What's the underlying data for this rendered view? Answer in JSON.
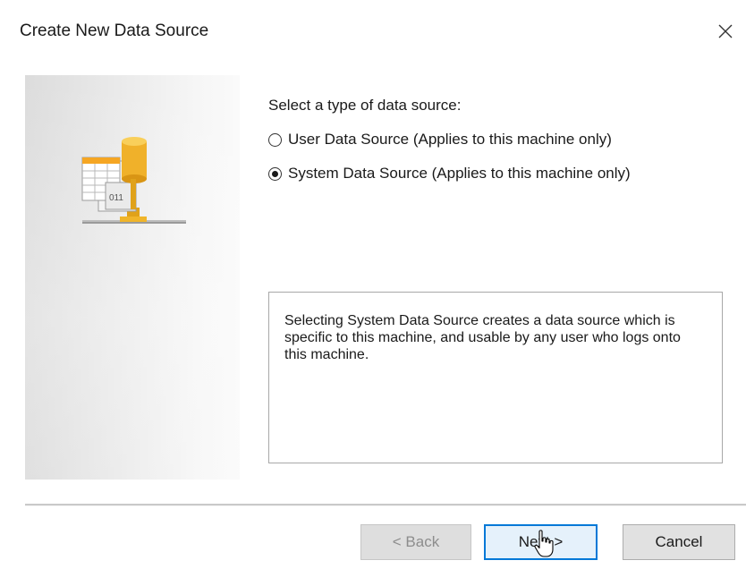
{
  "window": {
    "title": "Create New Data Source"
  },
  "icons": {
    "close": "close-icon",
    "wizard_art": "data-source-database-icon",
    "cursor": "hand-pointer-cursor"
  },
  "form": {
    "group_label": "Select a type of data source:",
    "options": [
      {
        "label": "User Data Source (Applies to this machine only)",
        "checked": false
      },
      {
        "label": "System Data Source (Applies to this machine only)",
        "checked": true
      }
    ],
    "description": "Selecting System Data Source creates a data source which is specific to this machine, and usable by any user who logs onto this machine."
  },
  "buttons": {
    "back": "< Back",
    "next": "Next >",
    "cancel": "Cancel"
  },
  "colors": {
    "focus_border": "#0078d7",
    "button_face": "#e1e1e1",
    "disabled_text": "#8d8d8d"
  }
}
